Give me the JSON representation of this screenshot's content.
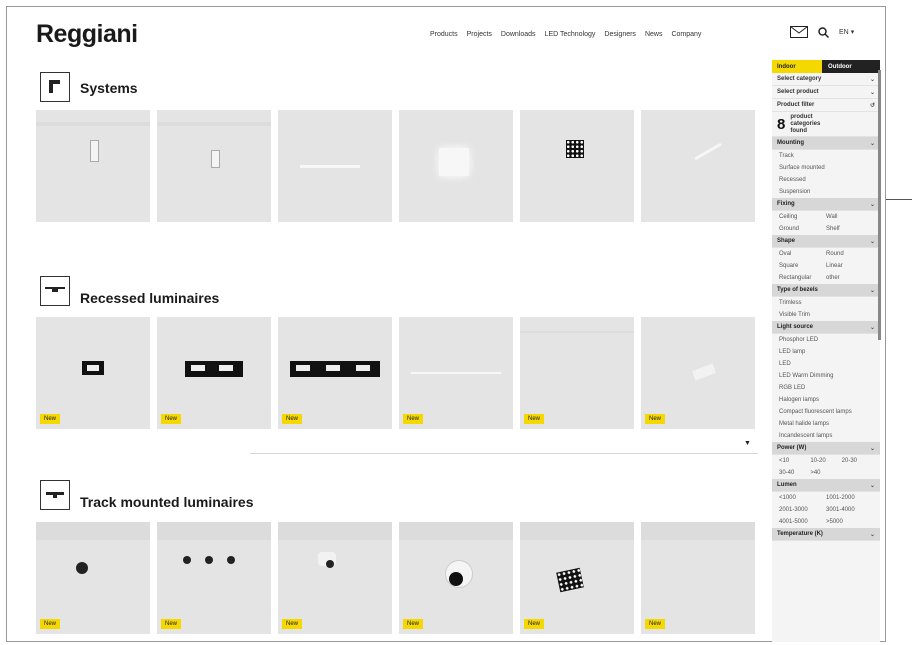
{
  "header": {
    "logo": "Reggiani",
    "nav": [
      "Products",
      "Projects",
      "Downloads",
      "LED Technology",
      "Designers",
      "News",
      "Company"
    ],
    "lang": "EN"
  },
  "sections": [
    {
      "title": "Systems",
      "icon": "systems-icon",
      "badges": [
        "",
        "",
        "",
        "",
        "",
        ""
      ]
    },
    {
      "title": "Recessed luminaires",
      "icon": "recessed-icon",
      "badges": [
        "New",
        "New",
        "New",
        "New",
        "New",
        "New"
      ]
    },
    {
      "title": "Track mounted luminaires",
      "icon": "track-icon",
      "badges": [
        "New",
        "New",
        "New",
        "New",
        "New",
        "New"
      ]
    }
  ],
  "panel": {
    "tab_left": "Indoor",
    "tab_right": "Outdoor",
    "select_category": "Select category",
    "select_product": "Select product",
    "product_filter": "Product filter",
    "count": "8",
    "count_text": "product categories found",
    "mounting": {
      "title": "Mounting",
      "items": [
        "Track",
        "Surface mounted",
        "Recessed",
        "Suspension"
      ]
    },
    "fixing": {
      "title": "Fixing",
      "items": [
        "Ceiling",
        "Wall",
        "Ground",
        "Shelf"
      ]
    },
    "shape": {
      "title": "Shape",
      "items": [
        "Oval",
        "Round",
        "Square",
        "Linear",
        "Rectangular",
        "other"
      ]
    },
    "bezels": {
      "title": "Type of bezels",
      "items": [
        "Trimless",
        "Visible Trim"
      ]
    },
    "light": {
      "title": "Light source",
      "items": [
        "Phosphor LED",
        "LED lamp",
        "LED",
        "LED Warm Dimming",
        "RGB LED",
        "Halogen lamps",
        "Compact fluorescent lamps",
        "Metal halide lamps",
        "Incandescent lamps"
      ]
    },
    "power": {
      "title": "Power (W)",
      "items": [
        "<10",
        "10-20",
        "20-30",
        "30-40",
        ">40"
      ]
    },
    "lumen": {
      "title": "Lumen",
      "items": [
        "<1000",
        "1001-2000",
        "2001-3000",
        "3001-4000",
        "4001-5000",
        ">5000"
      ]
    },
    "temperature": {
      "title": "Temperature (K)"
    }
  },
  "colors": {
    "accent": "#f5d800",
    "tile": "#e4e4e4",
    "dark": "#222222"
  }
}
